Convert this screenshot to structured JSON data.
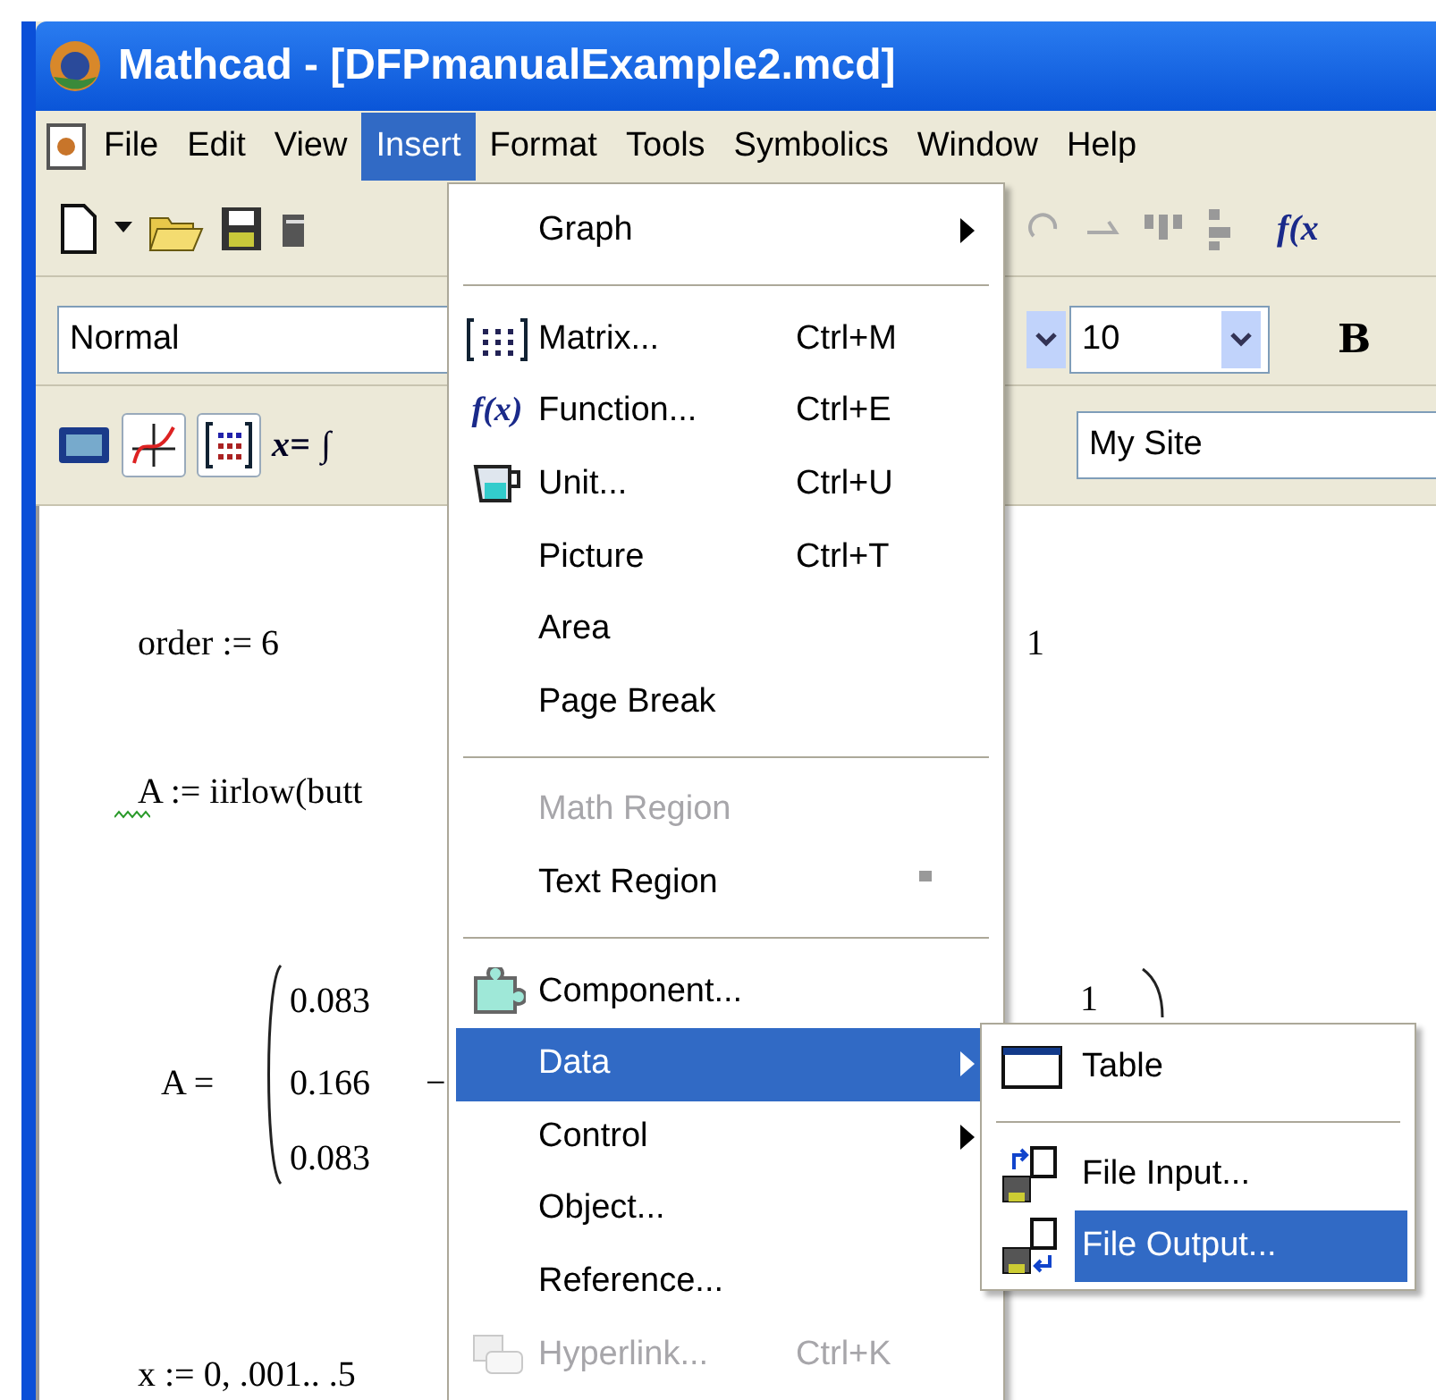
{
  "window": {
    "title": "Mathcad - [DFPmanualExample2.mcd]"
  },
  "menu_bar": [
    {
      "label": "File",
      "selected": false
    },
    {
      "label": "Edit",
      "selected": false
    },
    {
      "label": "View",
      "selected": false
    },
    {
      "label": "Insert",
      "selected": true
    },
    {
      "label": "Format",
      "selected": false
    },
    {
      "label": "Tools",
      "selected": false
    },
    {
      "label": "Symbolics",
      "selected": false
    },
    {
      "label": "Window",
      "selected": false
    },
    {
      "label": "Help",
      "selected": false
    }
  ],
  "standard_toolbar": {
    "function_label": "f(x"
  },
  "formatting_toolbar": {
    "style": "Normal",
    "font_size": "10",
    "bold_label": "B"
  },
  "math_toolbar": {
    "evaluation_label": "x=",
    "calculus_label": "∫"
  },
  "web_toolbar": {
    "address": "My Site"
  },
  "document": {
    "order_line": "order := 6",
    "order_side": "1",
    "filter_line": "A := iirlow(butt",
    "filter_flagged": true,
    "matrix": {
      "label": "A =",
      "rows": [
        [
          "0.083"
        ],
        [
          "0.166",
          "−"
        ],
        [
          "0.083"
        ]
      ],
      "side_value": "1"
    },
    "range_line": "x := 0, .001.. .5"
  },
  "insert_menu": [
    {
      "kind": "item",
      "label": "Graph",
      "submenu": true,
      "disabled": false,
      "selected": false,
      "marked": false
    },
    {
      "kind": "separator"
    },
    {
      "kind": "item",
      "label": "Matrix...",
      "shortcut": "Ctrl+M",
      "submenu": false,
      "disabled": false,
      "selected": false,
      "marked": false
    },
    {
      "kind": "item",
      "label": "Function...",
      "glyph": "f(x)",
      "shortcut": "Ctrl+E",
      "submenu": false,
      "disabled": false,
      "selected": false,
      "marked": false
    },
    {
      "kind": "item",
      "label": "Unit...",
      "shortcut": "Ctrl+U",
      "submenu": false,
      "disabled": false,
      "selected": false,
      "marked": false
    },
    {
      "kind": "item",
      "label": "Picture",
      "shortcut": "Ctrl+T",
      "submenu": false,
      "disabled": false,
      "selected": false,
      "marked": false
    },
    {
      "kind": "item",
      "label": "Area",
      "submenu": false,
      "disabled": false,
      "selected": false,
      "marked": false
    },
    {
      "kind": "item",
      "label": "Page Break",
      "submenu": false,
      "disabled": false,
      "selected": false,
      "marked": false
    },
    {
      "kind": "separator"
    },
    {
      "kind": "item",
      "label": "Math Region",
      "submenu": false,
      "disabled": true,
      "selected": false,
      "marked": false
    },
    {
      "kind": "item",
      "label": "Text Region",
      "submenu": false,
      "disabled": false,
      "selected": false,
      "marked": true
    },
    {
      "kind": "separator"
    },
    {
      "kind": "item",
      "label": "Component...",
      "submenu": false,
      "disabled": false,
      "selected": false,
      "marked": false
    },
    {
      "kind": "item",
      "label": "Data",
      "submenu": true,
      "disabled": false,
      "selected": true,
      "marked": false
    },
    {
      "kind": "item",
      "label": "Control",
      "submenu": true,
      "disabled": false,
      "selected": false,
      "marked": false
    },
    {
      "kind": "item",
      "label": "Object...",
      "submenu": false,
      "disabled": false,
      "selected": false,
      "marked": false
    },
    {
      "kind": "item",
      "label": "Reference...",
      "submenu": false,
      "disabled": false,
      "selected": false,
      "marked": false
    },
    {
      "kind": "item",
      "label": "Hyperlink...",
      "shortcut": "Ctrl+K",
      "submenu": false,
      "disabled": true,
      "selected": false,
      "marked": false
    }
  ],
  "data_submenu": [
    {
      "kind": "item",
      "label": "Table",
      "selected": false
    },
    {
      "kind": "separator"
    },
    {
      "kind": "item",
      "label": "File Input...",
      "selected": false
    },
    {
      "kind": "item",
      "label": "File Output...",
      "selected": true
    }
  ]
}
